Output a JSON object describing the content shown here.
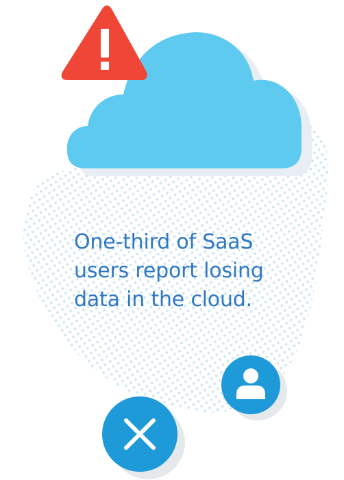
{
  "message": {
    "lines": [
      "One-third of SaaS",
      "users report losing",
      "data in the cloud."
    ]
  },
  "icons": {
    "warning": "warning-triangle-icon",
    "cloud": "cloud-icon",
    "user": "user-icon",
    "close": "close-x-icon"
  },
  "colors": {
    "text": "#2f78c2",
    "cloud": "#5fcaf0",
    "warning": "#ef4637",
    "badge": "#1e9ad8",
    "dots": "#cfe6f5",
    "shadow": "#e6e9ec"
  }
}
